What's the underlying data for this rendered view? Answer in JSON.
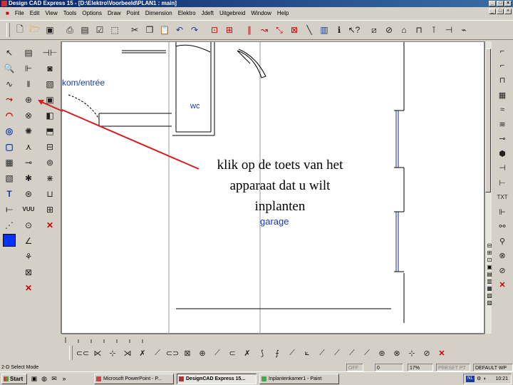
{
  "window": {
    "title": "Design CAD Express 15 - [D:\\Elektro\\Voorbeeld\\PLAN1 : main]",
    "controls": [
      "minimize",
      "maximize",
      "close"
    ]
  },
  "menu": [
    "File",
    "Edit",
    "View",
    "Tools",
    "Options",
    "Draw",
    "Point",
    "Dimension",
    "Elektro",
    "Jdeft",
    "Uitgebreid",
    "Window",
    "Help"
  ],
  "drawing": {
    "labels": {
      "kom": "kom/entrée",
      "wc": "wc",
      "garage": "garage"
    },
    "callout": {
      "lines": [
        "klik op de toets van het",
        "apparaat dat u wilt",
        "inplanten"
      ]
    },
    "colors": {
      "label_blue": "#1a3aa8",
      "arrow_red": "#d42020",
      "wall_blue": "#1a2a8a"
    }
  },
  "right_toolbar": {
    "text_tool": "TXT"
  },
  "left_toolbar": {
    "text_label": "VUU"
  },
  "status": {
    "mode": "2-D Select Mode",
    "snap": "OFF",
    "field1": "0",
    "zoom": "17%",
    "preset": "PRESET PT",
    "layer": "DEFAULT WP"
  },
  "taskbar": {
    "start": "Start",
    "tasks": [
      "Microsoft PowerPoint - P...",
      "DesignCAD Express 15...",
      "Inplantenkamer1 - Paint"
    ],
    "tray_lang": "NL",
    "clock": "10:21"
  }
}
